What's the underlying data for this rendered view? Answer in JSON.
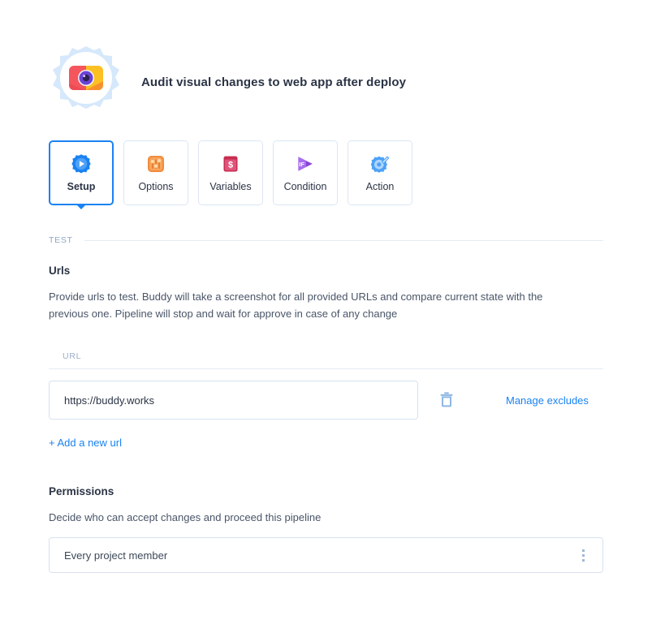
{
  "header": {
    "title": "Audit visual changes to web app after deploy",
    "icon": "buddy-visual-tests-gear-icon"
  },
  "tabs": [
    {
      "label": "Setup",
      "icon": "setup-gear-play-icon",
      "active": true
    },
    {
      "label": "Options",
      "icon": "options-sliders-icon",
      "active": false
    },
    {
      "label": "Variables",
      "icon": "variables-dollar-icon",
      "active": false
    },
    {
      "label": "Condition",
      "icon": "condition-if-play-icon",
      "active": false
    },
    {
      "label": "Action",
      "icon": "action-gear-wrench-icon",
      "active": false
    }
  ],
  "section": {
    "label": "TEST"
  },
  "urls": {
    "title": "Urls",
    "description": "Provide urls to test. Buddy will take a screenshot for all provided URLs and compare current state with the previous one. Pipeline will stop and wait for approve in case of any change",
    "field_label": "URL",
    "value": "https://buddy.works",
    "placeholder": "https://",
    "delete_icon": "trash-icon",
    "manage_excludes_label": "Manage excludes",
    "add_url_label": "+ Add a new url"
  },
  "permissions": {
    "title": "Permissions",
    "description": "Decide who can accept changes and proceed this pipeline",
    "selected": "Every project member",
    "menu_icon": "kebab-menu-icon"
  },
  "colors": {
    "accent_blue": "#1a82f2",
    "border_light": "#d6e2f0",
    "label_muted": "#9aaec9",
    "text_dark": "#2b3445"
  }
}
